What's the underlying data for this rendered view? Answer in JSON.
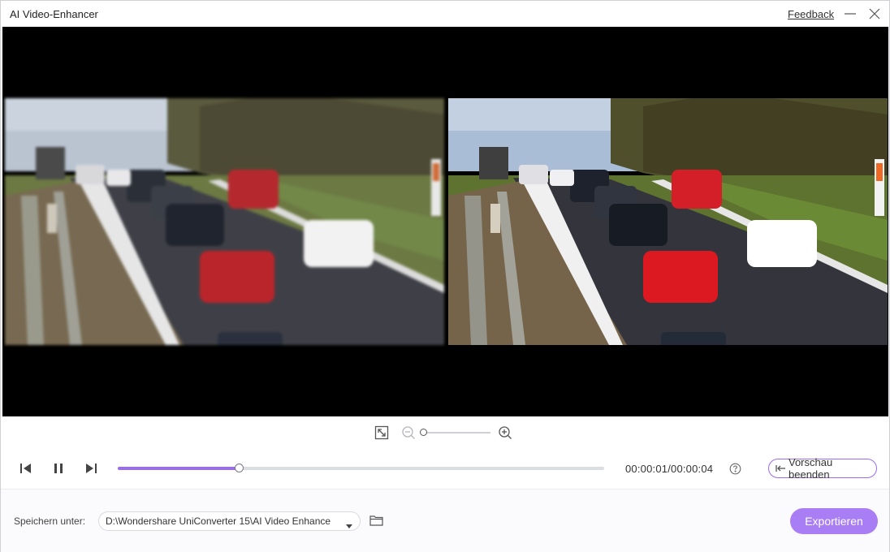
{
  "window": {
    "title": "AI Video-Enhancer",
    "feedback_label": "Feedback"
  },
  "icons": {
    "minimize": "minimize-icon",
    "close": "close-icon",
    "fit": "fit-screen-icon",
    "zoom_out": "zoom-out-icon",
    "zoom_in": "zoom-in-icon",
    "prev": "previous-frame-icon",
    "pause": "pause-icon",
    "next": "next-frame-icon",
    "help": "help-icon",
    "back": "back-arrow-icon",
    "folder": "folder-icon",
    "dropdown": "chevron-down-icon"
  },
  "preview": {
    "left_pane": "original",
    "right_pane": "enhanced"
  },
  "zoom": {
    "level": 0
  },
  "playback": {
    "progress": 0.25,
    "timecode": "00:00:01/00:00:04",
    "end_preview_label": "Vorschau beenden"
  },
  "output": {
    "save_label": "Speichern unter:",
    "path": "D:\\Wondershare UniConverter 15\\AI Video Enhance",
    "export_label": "Exportieren"
  },
  "colors": {
    "accent": "#9b6bf2",
    "export_button": "#a97ef4",
    "progress_track": "#dcdce3"
  }
}
